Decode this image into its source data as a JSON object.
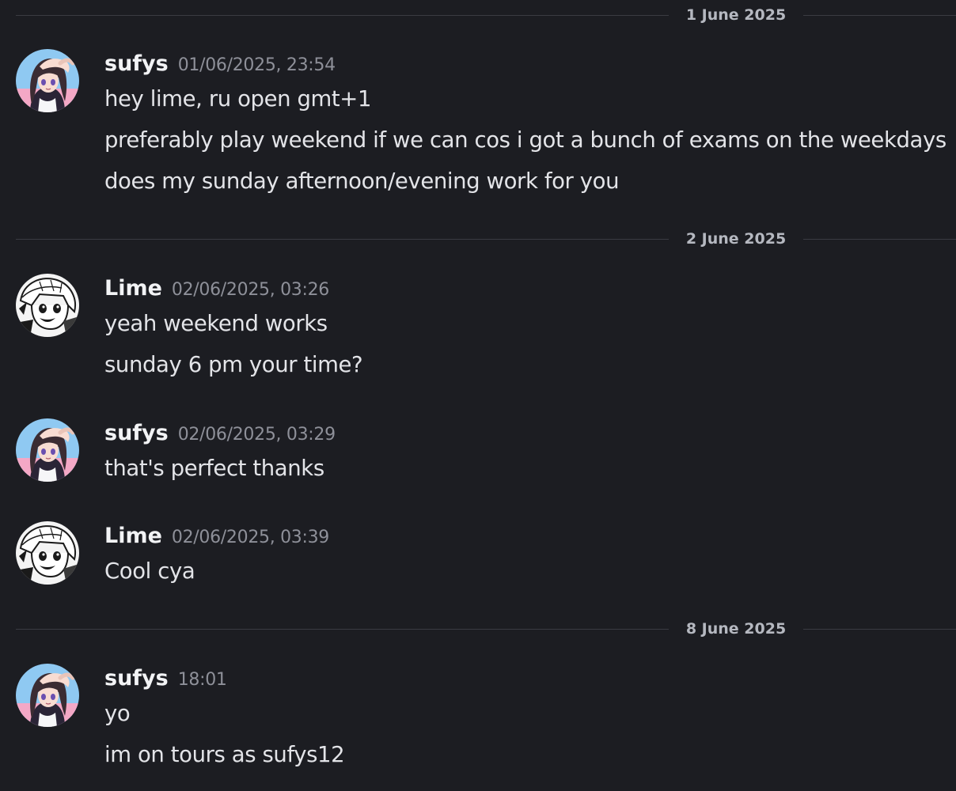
{
  "dividers": [
    "1 June 2025",
    "2 June 2025",
    "8 June 2025"
  ],
  "groups": [
    {
      "user": "sufys",
      "time": "01/06/2025, 23:54",
      "messages": [
        "hey lime, ru open gmt+1",
        "preferably play weekend if we can cos i got a bunch of exams on the weekdays",
        "does my sunday afternoon/evening work for you"
      ]
    },
    {
      "user": "Lime",
      "time": "02/06/2025, 03:26",
      "messages": [
        "yeah weekend works",
        "sunday 6 pm your time?"
      ]
    },
    {
      "user": "sufys",
      "time": "02/06/2025, 03:29",
      "messages": [
        "that's perfect thanks"
      ]
    },
    {
      "user": "Lime",
      "time": "02/06/2025, 03:39",
      "messages": [
        "Cool cya"
      ]
    },
    {
      "user": "sufys",
      "time": "18:01",
      "messages": [
        "yo",
        "im on tours as sufys12"
      ]
    }
  ],
  "colors": {
    "background": "#1c1d22",
    "divider_line": "#3a3b42",
    "divider_text": "#b5b8c0",
    "username": "#f2f3f5",
    "timestamp": "#8e9099",
    "message": "#e3e4e8"
  },
  "icons": {
    "sufys_avatar": "anime-girl-avatar-icon",
    "lime_avatar": "manga-character-avatar-icon"
  }
}
